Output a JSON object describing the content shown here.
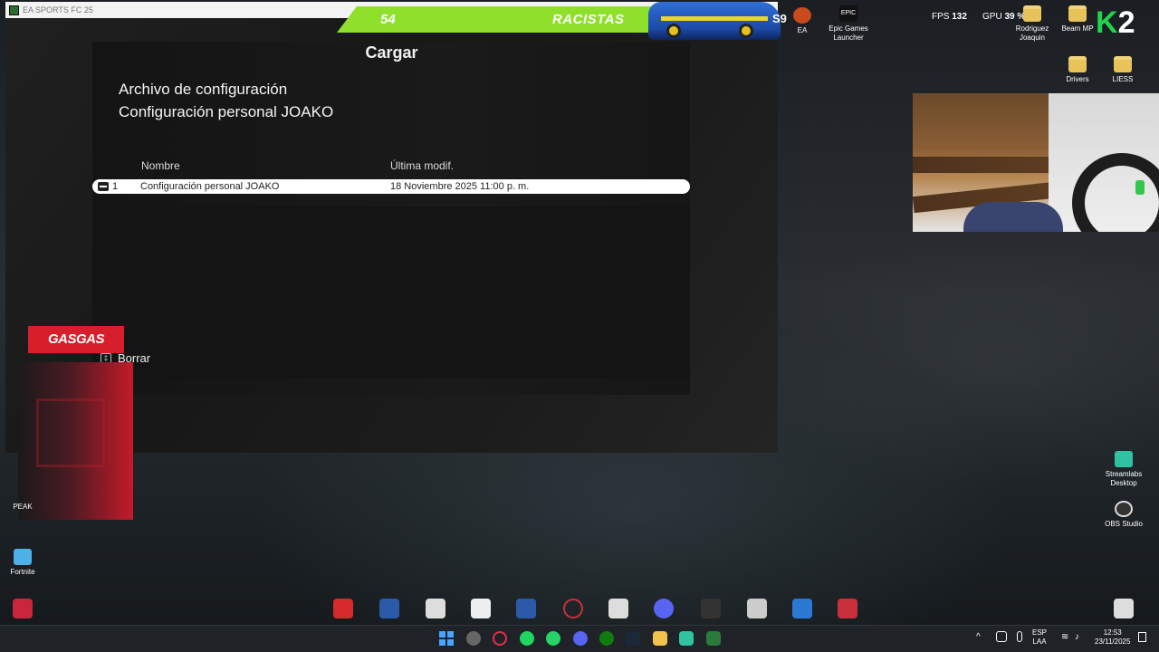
{
  "window": {
    "title": "EA SPORTS FC 25"
  },
  "load_screen": {
    "title": "Cargar",
    "heading_line1": "Archivo de configuración",
    "heading_line2": "Configuración personal JOAKO",
    "columns": {
      "name": "Nombre",
      "modified": "Última modif."
    },
    "rows": [
      {
        "index": "1",
        "name": "Configuración personal JOAKO",
        "modified": "18 Noviembre 2025 11:00 p. m."
      }
    ],
    "delete_key": "‡",
    "delete_label": "Borrar"
  },
  "overlay": {
    "banner_number": "54",
    "banner_text": "RACISTAS",
    "badge": "S9",
    "brand": "GASGAS",
    "banner_color": "#8ee02a"
  },
  "hud": {
    "fps_label": "FPS",
    "fps_value": "132",
    "gpu_label": "GPU",
    "gpu_value": "39 %"
  },
  "desktop_icons": {
    "ea": "EA",
    "epic_logo": "EPIC",
    "epic": "Epic Games Launcher",
    "rodriguez": "Rodriguez Joaquin",
    "beammp": "Beam MP",
    "drivers": "Drivers",
    "liess": "LIESS",
    "peak": "PEAK",
    "fortnite": "Fortnite",
    "streamlabs": "Streamlabs Desktop",
    "obs": "OBS Studio"
  },
  "taskbar": {
    "language": "ESP",
    "layout": "LAA",
    "time": "12:53",
    "date": "23/11/2025"
  }
}
